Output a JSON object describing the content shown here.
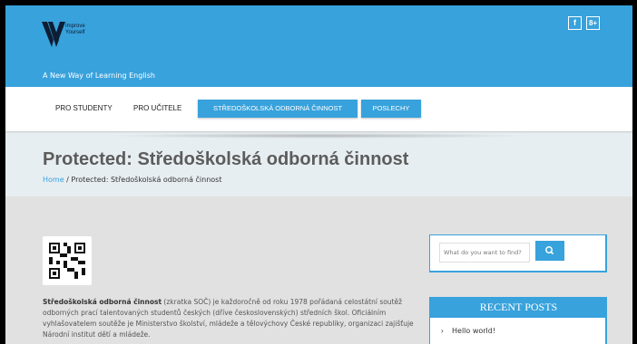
{
  "header": {
    "logo_line1": "Improve",
    "logo_line2": "Yourself",
    "tagline": "A New Way of Learning English",
    "social": [
      "f",
      "8+"
    ]
  },
  "nav": {
    "items": [
      {
        "label": "PRO STUDENTY"
      },
      {
        "label": "PRO UČITELE"
      },
      {
        "label": "STŘEDOŠKOLSKÁ ODBORNÁ ČINNOST"
      },
      {
        "label": "POSLECHY"
      }
    ]
  },
  "title": {
    "page_title": "Protected: Středoškolská odborná činnost",
    "breadcrumb_home": "Home",
    "breadcrumb_sep": "/",
    "breadcrumb_current": "Protected: Středoškolská odborná činnost"
  },
  "article": {
    "bold_term": "Středoškolská odborná činnost",
    "intro": " (zkratka SOČ) je každoročně od roku 1978 pořádaná celostátní soutěž odborných prací talentovaných studentů českých (dříve československých) středních škol. Oficiálním vyhlašovatelem soutěže je Ministerstvo školství, mládeže a tělovýchovy České republiky, organizaci zajišťuje Národní institut dětí a mládeže."
  },
  "sidebar": {
    "search_placeholder": "What do you want to find?",
    "recent_title": "RECENT POSTS",
    "recent_items": [
      {
        "label": "Hello world!"
      }
    ]
  },
  "colors": {
    "accent": "#38a2dc"
  }
}
